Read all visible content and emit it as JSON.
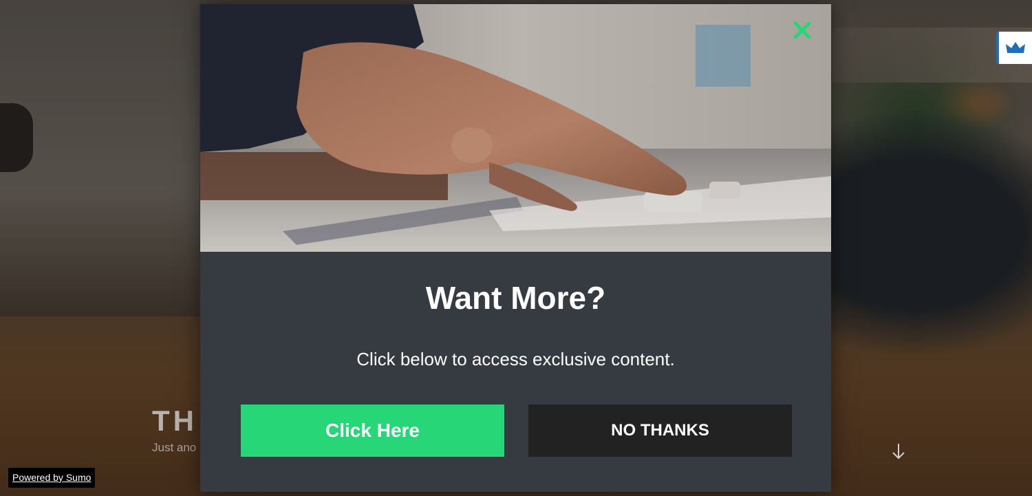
{
  "background_page": {
    "title": "TH",
    "subtitle": "Just ano"
  },
  "powered_by": "Powered by Sumo",
  "modal": {
    "heading": "Want More?",
    "subheading": "Click below to access exclusive content.",
    "primary_button": "Click Here",
    "secondary_button": "NO THANKS"
  },
  "icons": {
    "close": "close-icon",
    "scroll_down": "arrow-down-icon",
    "side_badge": "crown-icon"
  },
  "colors": {
    "accent_green": "#26d677",
    "modal_bg": "#363a41",
    "secondary_button": "#222222",
    "badge_blue": "#1e6fb8"
  }
}
